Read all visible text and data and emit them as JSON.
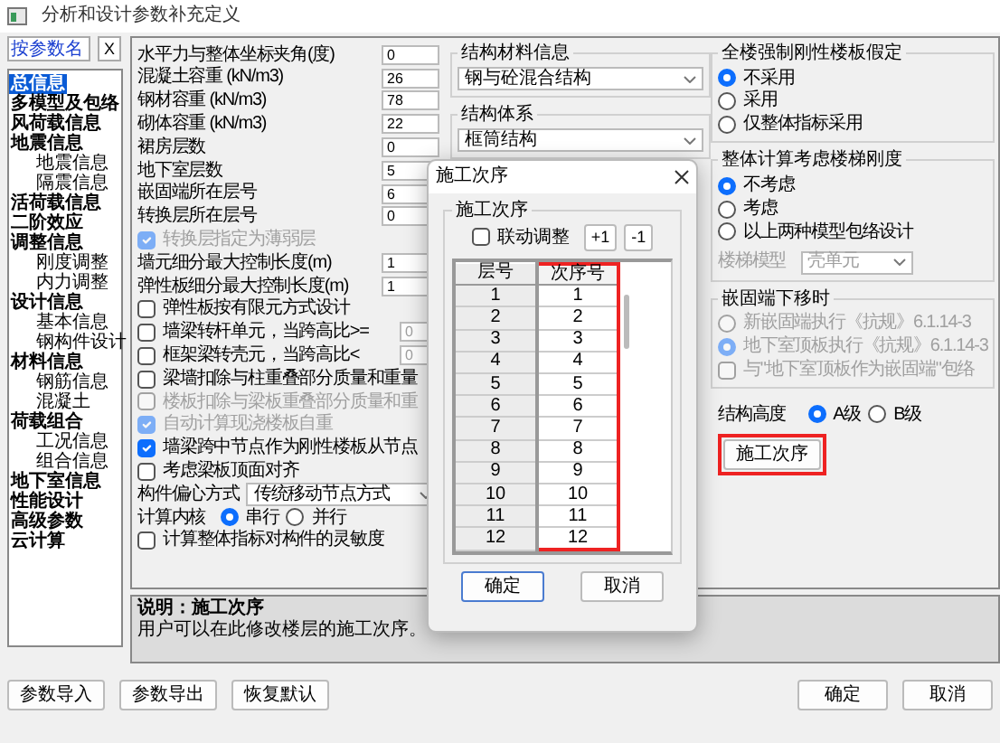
{
  "window": {
    "title": "分析和设计参数补充定义"
  },
  "search": {
    "placeholder": "按参数名",
    "clear": "X"
  },
  "sidebar": {
    "items": [
      {
        "label": "总信息",
        "selected": true
      },
      {
        "label": "多模型及包络",
        "selected": false
      },
      {
        "label": "风荷载信息",
        "selected": false
      },
      {
        "label": "地震信息",
        "selected": false,
        "children": [
          {
            "label": "地震信息",
            "selected": false
          },
          {
            "label": "隔震信息",
            "selected": false
          }
        ]
      },
      {
        "label": "活荷载信息",
        "selected": false
      },
      {
        "label": "二阶效应",
        "selected": false
      },
      {
        "label": "调整信息",
        "selected": false,
        "children": [
          {
            "label": "刚度调整",
            "selected": false
          },
          {
            "label": "内力调整",
            "selected": false
          }
        ]
      },
      {
        "label": "设计信息",
        "selected": false,
        "children": [
          {
            "label": "基本信息",
            "selected": false
          },
          {
            "label": "钢构件设计",
            "selected": false
          }
        ]
      },
      {
        "label": "材料信息",
        "selected": false,
        "children": [
          {
            "label": "钢筋信息",
            "selected": false
          },
          {
            "label": "混凝土",
            "selected": false
          }
        ]
      },
      {
        "label": "荷载组合",
        "selected": false,
        "children": [
          {
            "label": "工况信息",
            "selected": false
          },
          {
            "label": "组合信息",
            "selected": false
          }
        ]
      },
      {
        "label": "地下室信息",
        "selected": false
      },
      {
        "label": "性能设计",
        "selected": false
      },
      {
        "label": "高级参数",
        "selected": false
      },
      {
        "label": "云计算",
        "selected": false
      }
    ]
  },
  "general": {
    "rows": [
      {
        "kind": "field",
        "label": "水平力与整体坐标夹角(度)",
        "value": "0"
      },
      {
        "kind": "field",
        "label": "混凝土容重 (kN/m3)",
        "value": "26"
      },
      {
        "kind": "field",
        "label": "钢材容重 (kN/m3)",
        "value": "78"
      },
      {
        "kind": "field",
        "label": "砌体容重 (kN/m3)",
        "value": "22"
      },
      {
        "kind": "field",
        "label": "裙房层数",
        "value": "0"
      },
      {
        "kind": "field",
        "label": "地下室层数",
        "value": "5"
      },
      {
        "kind": "field",
        "label": "嵌固端所在层号",
        "value": "6"
      },
      {
        "kind": "field",
        "label": "转换层所在层号",
        "value": "0"
      },
      {
        "kind": "checkbox",
        "label": "转换层指定为薄弱层",
        "checked": true,
        "disabled": true
      },
      {
        "kind": "field",
        "label": "墙元细分最大控制长度(m)",
        "value": "1"
      },
      {
        "kind": "field",
        "label": "弹性板细分最大控制长度(m)",
        "value": "1"
      },
      {
        "kind": "checkbox",
        "label": "弹性板按有限元方式设计",
        "checked": false,
        "disabled": false
      },
      {
        "kind": "checkbox_field",
        "label": "墙梁转杆单元，当跨高比>=",
        "checked": false,
        "disabled": false,
        "value": "0"
      },
      {
        "kind": "checkbox_field",
        "label": "框架梁转壳元，当跨高比<",
        "checked": false,
        "disabled": false,
        "value": "0"
      },
      {
        "kind": "checkbox",
        "label": "梁墙扣除与柱重叠部分质量和重量",
        "checked": false,
        "disabled": false
      },
      {
        "kind": "checkbox",
        "label": "楼板扣除与梁板重叠部分质量和重",
        "checked": false,
        "disabled": true
      },
      {
        "kind": "checkbox",
        "label": "自动计算现浇楼板自重",
        "checked": true,
        "disabled": true
      },
      {
        "kind": "checkbox",
        "label": "墙梁跨中节点作为刚性楼板从节点",
        "checked": true,
        "disabled": false
      },
      {
        "kind": "checkbox",
        "label": "考虑梁板顶面对齐",
        "checked": false,
        "disabled": false
      },
      {
        "kind": "select",
        "label": "构件偏心方式",
        "value": "传统移动节点方式"
      },
      {
        "kind": "radio",
        "label": "计算内核",
        "options": [
          {
            "label": "串行",
            "selected": true
          },
          {
            "label": "并行",
            "selected": false
          }
        ]
      },
      {
        "kind": "checkbox",
        "label": "计算整体指标对构件的灵敏度",
        "checked": false,
        "disabled": false
      }
    ]
  },
  "structure": [
    {
      "title": "结构材料信息",
      "value": "钢与砼混合结构"
    },
    {
      "title": "结构体系",
      "value": "框筒结构"
    }
  ],
  "rigid_floor": {
    "title": "全楼强制刚性楼板假定",
    "options": [
      {
        "label": "不采用",
        "selected": true
      },
      {
        "label": "采用",
        "selected": false
      },
      {
        "label": "仅整体指标采用",
        "selected": false
      }
    ]
  },
  "stair": {
    "title": "整体计算考虑楼梯刚度",
    "options": [
      {
        "label": "不考虑",
        "selected": true
      },
      {
        "label": "考虑",
        "selected": false
      },
      {
        "label": "以上两种模型包络设计",
        "selected": false
      }
    ],
    "model": {
      "label": "楼梯模型",
      "value": "壳单元",
      "disabled": true
    }
  },
  "embed": {
    "title": "嵌固端下移时",
    "options": [
      {
        "kind": "radio",
        "label": "新嵌固端执行《抗规》6.1.14-3",
        "selected": false,
        "disabled": true
      },
      {
        "kind": "radio",
        "label": "地下室顶板执行《抗规》6.1.14-3",
        "selected": true,
        "disabled": true
      },
      {
        "kind": "checkbox",
        "label": "与\"地下室顶板作为嵌固端\"包络",
        "selected": false,
        "disabled": true
      }
    ]
  },
  "height": {
    "label": "结构高度",
    "options": [
      {
        "label": "A级",
        "selected": true
      },
      {
        "label": "B级",
        "selected": false
      }
    ]
  },
  "sequence_button": {
    "label": "施工次序",
    "highlighted": true
  },
  "description": {
    "title": "说明：施工次序",
    "text": "用户可以在此修改楼层的施工次序。"
  },
  "footer": {
    "left": [
      "参数导入",
      "参数导出",
      "恢复默认"
    ],
    "right": [
      "确定",
      "取消"
    ]
  },
  "dialog": {
    "title": "施工次序",
    "group": "施工次序",
    "link": {
      "label": "联动调整",
      "checked": false
    },
    "steps": [
      "+1",
      "-1"
    ],
    "columns": [
      {
        "label": "层号",
        "highlighted": false
      },
      {
        "label": "次序号",
        "highlighted": true
      }
    ],
    "rows": [
      [
        "1",
        "1"
      ],
      [
        "2",
        "2"
      ],
      [
        "3",
        "3"
      ],
      [
        "4",
        "4"
      ],
      [
        "5",
        "5"
      ],
      [
        "6",
        "6"
      ],
      [
        "7",
        "7"
      ],
      [
        "8",
        "8"
      ],
      [
        "9",
        "9"
      ],
      [
        "10",
        "10"
      ],
      [
        "11",
        "11"
      ],
      [
        "12",
        "12"
      ]
    ],
    "buttons": [
      "确定",
      "取消"
    ]
  }
}
